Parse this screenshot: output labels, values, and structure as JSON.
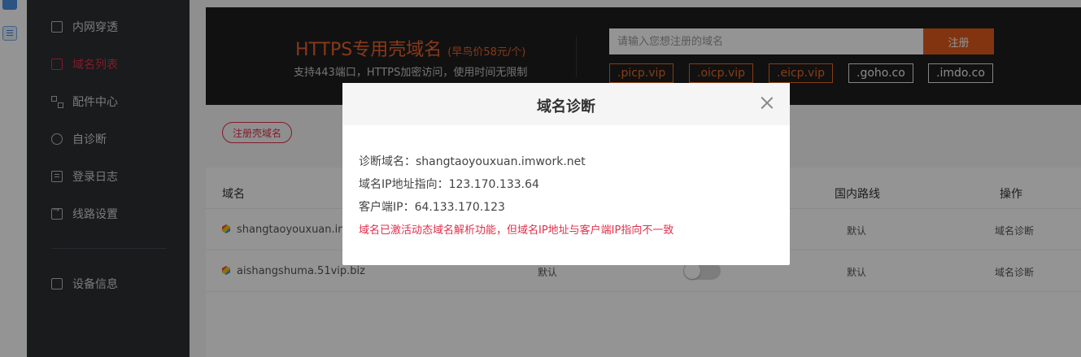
{
  "strip": {
    "icons": [
      "mail-icon",
      "document-icon"
    ]
  },
  "sidebar": {
    "items": [
      {
        "label": "内网穿透",
        "icon": "monitor-icon"
      },
      {
        "label": "域名列表",
        "icon": "domain-list-icon",
        "active": true
      },
      {
        "label": "配件中心",
        "icon": "grid-icon"
      },
      {
        "label": "自诊断",
        "icon": "diagnose-icon"
      },
      {
        "label": "登录日志",
        "icon": "log-icon"
      },
      {
        "label": "线路设置",
        "icon": "route-icon"
      },
      {
        "label": "设备信息",
        "icon": "device-icon"
      }
    ]
  },
  "banner": {
    "title": "HTTPS专用壳域名",
    "price": "(早鸟价58元/个)",
    "subtitle": "支持443端口，HTTPS加密访问，使用时间无限制",
    "search_placeholder": "请输入您想注册的域名",
    "register_label": "注册",
    "tlds": [
      ".picp.vip",
      ".oicp.vip",
      ".eicp.vip",
      ".goho.co",
      ".imdo.co"
    ]
  },
  "register_shell_label": "注册壳域名",
  "table": {
    "headers": {
      "domain": "域名",
      "route": "国内路线",
      "action": "操作"
    },
    "rows": [
      {
        "domain": "shangtaoyouxuan.imw",
        "route": "默认",
        "action": "域名诊断"
      },
      {
        "domain": "aishangshuma.51vip.biz",
        "type": "默认",
        "route": "默认",
        "action": "域名诊断"
      }
    ]
  },
  "modal": {
    "title": "域名诊断",
    "line1": "诊断域名：shangtaoyouxuan.imwork.net",
    "line2": "域名IP地址指向：123.170.133.64",
    "line3": "客户端IP：64.133.170.123",
    "warning": "域名已激活动态域名解析功能，但域名IP地址与客户端IP指向不一致"
  },
  "colors": {
    "accent": "#e0304b",
    "orange": "#e15a1e",
    "sidebar_bg": "#2b2f33"
  }
}
